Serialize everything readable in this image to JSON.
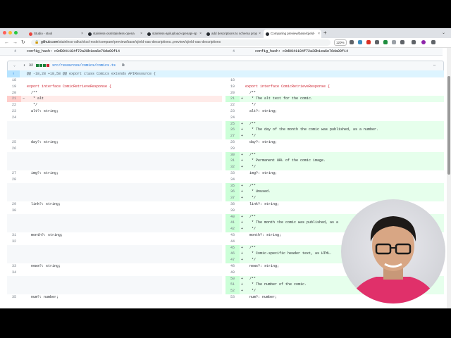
{
  "browser": {
    "tabs": [
      {
        "label": "Studio - stool",
        "favicon_color": "#e8453c"
      },
      {
        "label": "stainless-oss/stainless-opena",
        "favicon_color": "#24292f"
      },
      {
        "label": "stainless-api/upload-openapi-sp",
        "favicon_color": "#24292f"
      },
      {
        "label": "add descriptions to schema prop",
        "favicon_color": "#24292f"
      },
      {
        "label": "Comparing preview/base/cjield-",
        "favicon_color": "#24292f",
        "active": true
      }
    ],
    "url_domain": "github.com",
    "url_path": "/stainless-sdks/xkcd-node/compare/preview/base/cjield-oas-descriptions..preview/cjield-oas-descriptions",
    "zoom": "120%"
  },
  "diff": {
    "context_row": {
      "left_num": "4",
      "left_code": "config_hash: c9d0941184f72a28b1ea6e76da09f14",
      "right_num": "4",
      "right_code": "config_hash: c9d0941184f72a28b1ea6e76da09f14"
    },
    "file": {
      "changes": "32",
      "path": "src/resources/comics/comics.ts"
    },
    "hunk_header": "@@ -18,28 +18,58 @@ export class Comics extends APIResource {",
    "left_rows": [
      {
        "num": "18",
        "code": ""
      },
      {
        "num": "19",
        "code": "export interface ComicRetrieveResponse {",
        "kw": true
      },
      {
        "num": "20",
        "code": "  /**"
      },
      {
        "num": "21",
        "code": "   * alt",
        "type": "del",
        "mark": "−"
      },
      {
        "num": "22",
        "code": "   */"
      },
      {
        "num": "23",
        "code": "  alt?: string;"
      },
      {
        "num": "24",
        "code": ""
      },
      {
        "num": "",
        "code": "",
        "type": "empty"
      },
      {
        "num": "",
        "code": "",
        "type": "empty"
      },
      {
        "num": "",
        "code": "",
        "type": "empty"
      },
      {
        "num": "25",
        "code": "  day?: string;"
      },
      {
        "num": "26",
        "code": ""
      },
      {
        "num": "",
        "code": "",
        "type": "empty"
      },
      {
        "num": "",
        "code": "",
        "type": "empty"
      },
      {
        "num": "",
        "code": "",
        "type": "empty"
      },
      {
        "num": "27",
        "code": "  img?: string;"
      },
      {
        "num": "28",
        "code": ""
      },
      {
        "num": "",
        "code": "",
        "type": "empty"
      },
      {
        "num": "",
        "code": "",
        "type": "empty"
      },
      {
        "num": "",
        "code": "",
        "type": "empty"
      },
      {
        "num": "29",
        "code": "  link?: string;"
      },
      {
        "num": "30",
        "code": ""
      },
      {
        "num": "",
        "code": "",
        "type": "empty"
      },
      {
        "num": "",
        "code": "",
        "type": "empty"
      },
      {
        "num": "",
        "code": "",
        "type": "empty"
      },
      {
        "num": "31",
        "code": "  month?: string;"
      },
      {
        "num": "32",
        "code": ""
      },
      {
        "num": "",
        "code": "",
        "type": "empty"
      },
      {
        "num": "",
        "code": "",
        "type": "empty"
      },
      {
        "num": "",
        "code": "",
        "type": "empty"
      },
      {
        "num": "33",
        "code": "  news?: string;"
      },
      {
        "num": "34",
        "code": ""
      },
      {
        "num": "",
        "code": "",
        "type": "empty"
      },
      {
        "num": "",
        "code": "",
        "type": "empty"
      },
      {
        "num": "",
        "code": "",
        "type": "empty"
      },
      {
        "num": "35",
        "code": "  num?: number;"
      }
    ],
    "right_rows": [
      {
        "num": "18",
        "code": ""
      },
      {
        "num": "19",
        "code": "export interface ComicRetrieveResponse {",
        "kw": true
      },
      {
        "num": "20",
        "code": "  /**"
      },
      {
        "num": "21",
        "code": "   * The alt text for the comic.",
        "type": "add",
        "mark": "+"
      },
      {
        "num": "22",
        "code": "   */"
      },
      {
        "num": "23",
        "code": "  alt?: string;"
      },
      {
        "num": "24",
        "code": ""
      },
      {
        "num": "25",
        "code": "  /**",
        "type": "add",
        "mark": "+"
      },
      {
        "num": "26",
        "code": "   * The day of the month the comic was published, as a number.",
        "type": "add",
        "mark": "+"
      },
      {
        "num": "27",
        "code": "   */",
        "type": "add",
        "mark": "+"
      },
      {
        "num": "28",
        "code": "  day?: string;"
      },
      {
        "num": "29",
        "code": ""
      },
      {
        "num": "30",
        "code": "  /**",
        "type": "add",
        "mark": "+"
      },
      {
        "num": "31",
        "code": "   * Permanent URL of the comic image.",
        "type": "add",
        "mark": "+"
      },
      {
        "num": "32",
        "code": "   */",
        "type": "add",
        "mark": "+"
      },
      {
        "num": "33",
        "code": "  img?: string;"
      },
      {
        "num": "34",
        "code": ""
      },
      {
        "num": "35",
        "code": "  /**",
        "type": "add",
        "mark": "+"
      },
      {
        "num": "36",
        "code": "   * Unused.",
        "type": "add",
        "mark": "+"
      },
      {
        "num": "37",
        "code": "   */",
        "type": "add",
        "mark": "+"
      },
      {
        "num": "38",
        "code": "  link?: string;"
      },
      {
        "num": "39",
        "code": ""
      },
      {
        "num": "40",
        "code": "  /**",
        "type": "add",
        "mark": "+"
      },
      {
        "num": "41",
        "code": "   * The month the comic was published, as a",
        "type": "add",
        "mark": "+"
      },
      {
        "num": "42",
        "code": "   */",
        "type": "add",
        "mark": "+"
      },
      {
        "num": "43",
        "code": "  month?: string;"
      },
      {
        "num": "44",
        "code": ""
      },
      {
        "num": "45",
        "code": "  /**",
        "type": "add",
        "mark": "+"
      },
      {
        "num": "46",
        "code": "   * Comic-specific header text, as HTML.",
        "type": "add",
        "mark": "+"
      },
      {
        "num": "47",
        "code": "   */",
        "type": "add",
        "mark": "+"
      },
      {
        "num": "48",
        "code": "  news?: string;"
      },
      {
        "num": "49",
        "code": ""
      },
      {
        "num": "50",
        "code": "  /**",
        "type": "add",
        "mark": "+"
      },
      {
        "num": "51",
        "code": "   * The number of the comic.",
        "type": "add",
        "mark": "+"
      },
      {
        "num": "52",
        "code": "   */",
        "type": "add",
        "mark": "+"
      },
      {
        "num": "53",
        "code": "  num?: number;"
      }
    ]
  },
  "colors": {
    "del_bg": "#ffebe9",
    "del_num_bg": "#ffcecb",
    "add_bg": "#e6ffec",
    "add_num_bg": "#ccffd8",
    "empty_bg": "#f6f8fa"
  }
}
